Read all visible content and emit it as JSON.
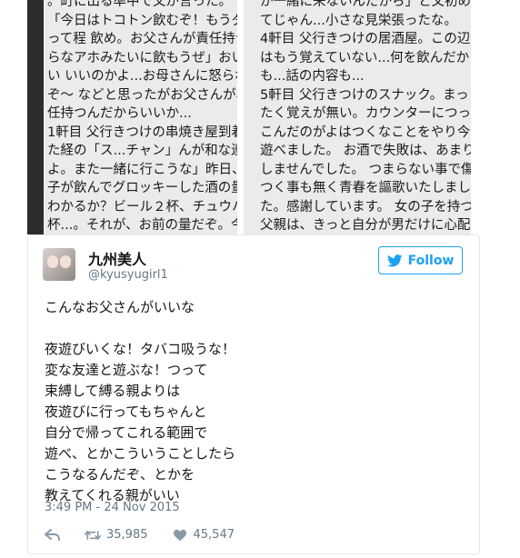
{
  "photo": {
    "left_text": "。町に出る準中で父が言った。\n「今日はトコトン飲むぞ！もうダメ\nって程 飲め。お父さんが責任持つか\nらなアホみたいに飲もうぜ」おいお\nい いいのかよ...お母さんに怒られる\nぞ〜 などと思ったがお父さんが、責\n任持つんだからいいか...\n1軒目 父行きつけの串焼き屋到着。\nた経の「ス...チャン」んが和な連れて\nよ。また一緒に行こうな」昨日、麗\n子が飲んでグロッキーした酒の量は\nわかるか？ビール２杯、チュウハイ５\n杯...。それが、お前の量だぞ。今\n度、誰かと飲みに行っても、その量\nの手前で帰ってこい 世の中はいい奴\nばかりじゃない。 騙してどっかに連",
    "right_text": "か一緒に来ないんだから」と父初め\nてじゃん...小さな見栄張ったな。\n4軒目 父行きつけの居酒屋。この辺\nはもう覚えていない...何を飲んだか\nも...話の内容も...\n5軒目 父行きつけのスナック。まっ\nたく覚えが無い。カウンターにつっ\nこんだのがよはつくなことをやり今系さ\n遊べました。 お酒で失敗は、あまり\nしませんでした。 つまらない事で傷\nつく事も無く青春を謳歌いたしまし\nた。感謝しています。 女の子を持つ\n父親は、きっと自分が男だけに心配\nなんだろう。父も昔のようにカッコ\n良くはなくなった。もう、お爺ちゃ"
  },
  "tweet": {
    "display_name": "九州美人",
    "handle": "@kyusyugirl1",
    "follow_label": "Follow",
    "text": "こんなお父さんがいいな\n\n夜遊びいくな！タバコ吸うな！\n変な友達と遊ぶな！つって\n束縛して縛る親よりは\n夜遊びに行ってもちゃんと\n自分で帰ってこれる範囲で\n遊べ、とかこういうことしたら\nこうなるんだぞ、とかを\n教えてくれる親がいい",
    "timestamp": "3:49 PM - 24 Nov 2015",
    "retweet_count": "35,985",
    "like_count": "45,547"
  },
  "colors": {
    "brand": "#1da1f2",
    "muted": "#657786",
    "text": "#14171a"
  },
  "icons": [
    "reply-icon",
    "retweet-icon",
    "heart-icon",
    "twitter-bird-icon"
  ]
}
